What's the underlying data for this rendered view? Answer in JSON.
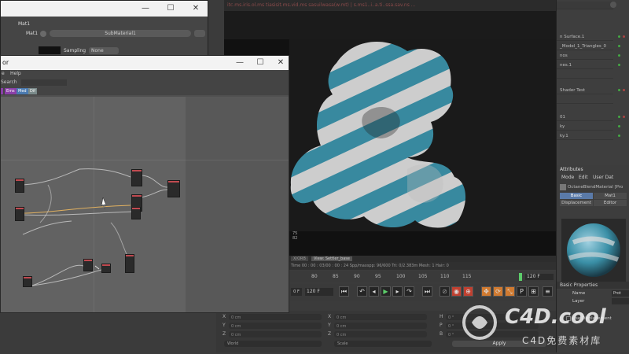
{
  "top_status": "itc.ms.iris.ol.ms  tiasisit.ms.vid.ms  sasuilwasa(w.mt) | s.ms1..i..a.ti..ssa.sav.ns ...",
  "material_window": {
    "tab_title": "Mat1",
    "slot_label": "Mat1",
    "submaterial_value": "SubMaterial1",
    "sampling_label": "Sampling",
    "sampling_value": "None",
    "min_label": "—",
    "max_label": "☐",
    "close_label": "✕"
  },
  "node_window": {
    "title": "or",
    "menus": [
      "e",
      "Help"
    ],
    "search_label": "Search",
    "tags": [
      {
        "label": "Ems",
        "color": "#8a3fa8"
      },
      {
        "label": "Med",
        "color": "#4a7ab0"
      },
      {
        "label": "Dif",
        "color": "#7a8a8a"
      }
    ],
    "min_label": "—",
    "max_label": "☐",
    "close_label": "✕"
  },
  "viewport": {
    "info_line": "Time 00 : 00 : 03/00 : 00 : 24  Spp/maxspp: 96/600    Tri: 0/2.383m    Mesh: 1   Hair: 0",
    "tab_a": "X/ORB",
    "tab_b": "View: Settler_base",
    "side_nums": [
      "75",
      "82"
    ]
  },
  "timeline": {
    "ticks": [
      "80",
      "85",
      "90",
      "95",
      "100",
      "105",
      "110",
      "115"
    ],
    "frame_field": "120 F",
    "frame_field_left": "120 F",
    "current": "0 F"
  },
  "coordinates": {
    "rows": [
      {
        "a": "X",
        "av": "0 cm",
        "b": "X",
        "bv": "0 cm",
        "c": "H",
        "cv": "0 °"
      },
      {
        "a": "Y",
        "av": "0 cm",
        "b": "Y",
        "bv": "0 cm",
        "c": "P",
        "cv": "0 °"
      },
      {
        "a": "Z",
        "av": "0 cm",
        "b": "Z",
        "bv": "0 cm",
        "c": "B",
        "cv": "0 °"
      }
    ],
    "mode_a": "World",
    "mode_b": "Scale",
    "apply_label": "Apply"
  },
  "objects": [
    "n Surface.1",
    "_Model_1_Triangles_0",
    "nos",
    "nes.1",
    "",
    "Shader Test",
    "",
    "01",
    "ky",
    "ky.1"
  ],
  "attributes": {
    "header": "Attributes",
    "menus": [
      "Mode",
      "Edit",
      "User Dat"
    ],
    "material_name": "OctaneBlendMaterial [Pro",
    "tabs_row1": [
      "Basic",
      "Mat1"
    ],
    "tabs_row2": [
      "Displacement",
      "Editor"
    ],
    "section": "Basic Properties",
    "props": [
      {
        "label": "Name",
        "value": "Prot"
      },
      {
        "label": "Layer",
        "value": ""
      },
      {
        "label": "",
        "value": ""
      },
      {
        "label": "Use Displacement",
        "value": ""
      }
    ]
  },
  "watermark": {
    "main": "C4D.cool",
    "sub": "C4D免费素材库"
  },
  "colors": {
    "accent_teal": "#3a8fa6",
    "node_header": "#c04a50",
    "panel": "#3d3d3d"
  }
}
